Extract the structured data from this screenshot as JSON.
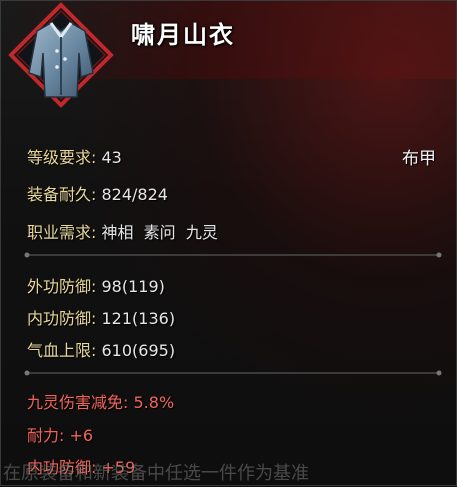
{
  "item": {
    "name": "啸月山衣",
    "type": "布甲",
    "icon": "robe-icon"
  },
  "base_stats": [
    {
      "label": "等级要求:",
      "value": "43"
    },
    {
      "label": "装备耐久:",
      "value": "824/824"
    },
    {
      "label": "职业需求:",
      "value": "神相  素问  九灵"
    }
  ],
  "defense_stats": [
    {
      "label": "外功防御:",
      "value": "98(119)"
    },
    {
      "label": "内功防御:",
      "value": "121(136)"
    },
    {
      "label": "气血上限:",
      "value": "610(695)"
    }
  ],
  "bonus_stats": [
    {
      "label": "九灵伤害减免:",
      "value": "5.8%"
    },
    {
      "label": "耐力:",
      "value": "+6"
    },
    {
      "label": "内功防御:",
      "value": "+59"
    }
  ],
  "bottom_hint": "在原装备和新装备中任选一件作为基准",
  "colors": {
    "label_gold": "#e8d79a",
    "value_white": "#e6e6e6",
    "bonus_red": "#f0655a",
    "frame_red": "#c0282a"
  }
}
